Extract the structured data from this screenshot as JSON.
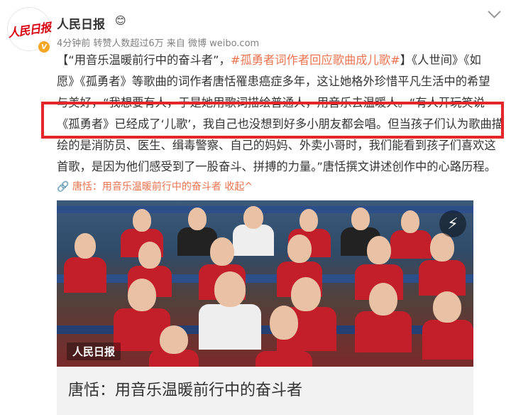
{
  "user": {
    "name": "人民日报",
    "avatar_text": "人民日报",
    "badge": "😊",
    "verified_symbol": "V"
  },
  "meta": "4分钟前 转赞人数超过6万 来自 微博 weibo.com",
  "post": {
    "lines": [
      [
        {
          "t": "【“用音乐温暖前行中的奋斗者”，",
          "c": "normal"
        },
        {
          "t": "#孤勇者词作者回应歌曲成儿歌#",
          "c": "link"
        },
        {
          "t": "】《人世间》《如",
          "c": "normal"
        }
      ],
      [
        {
          "t": "愿》《孤勇者》等歌曲的词作者唐恬罹患癌症多年，这让她格外珍惜平凡生活中的希望",
          "c": "normal"
        }
      ],
      [
        {
          "t": "与美好，“我想要有人，于是她用歌词描绘普通人，用音乐去温暖人。“有人开玩笑说",
          "c": "normal"
        }
      ],
      [
        {
          "t": "《孤勇者》已经成了‘儿歌’，我自己也没想到好多小朋友都会唱。但当孩子们认为歌曲描",
          "c": "normal"
        }
      ],
      [
        {
          "t": "绘的是消防员、医生、缉毒警察、自己的妈妈、外卖小哥时，我们能看到孩子们喜欢这",
          "c": "normal"
        }
      ],
      [
        {
          "t": "首歌，是因为他们感受到了一股奋斗、拼搏的力量。”唐恬撰文讲述创作中的心路历程。",
          "c": "normal"
        }
      ]
    ]
  },
  "reference": {
    "icon": "🔗",
    "text": "唐恬：用音乐温暖前行中的奋斗者",
    "collapse": "收起",
    "collapse_icon": "^"
  },
  "photo": {
    "watermark": "人民日报",
    "flash_icon": "⚡"
  },
  "card": {
    "title": "唐恬：用音乐温暖前行中的奋斗者"
  },
  "colors": {
    "link": "#eb7350",
    "highlight": "#e4262b",
    "brand_red": "#d7000f"
  }
}
